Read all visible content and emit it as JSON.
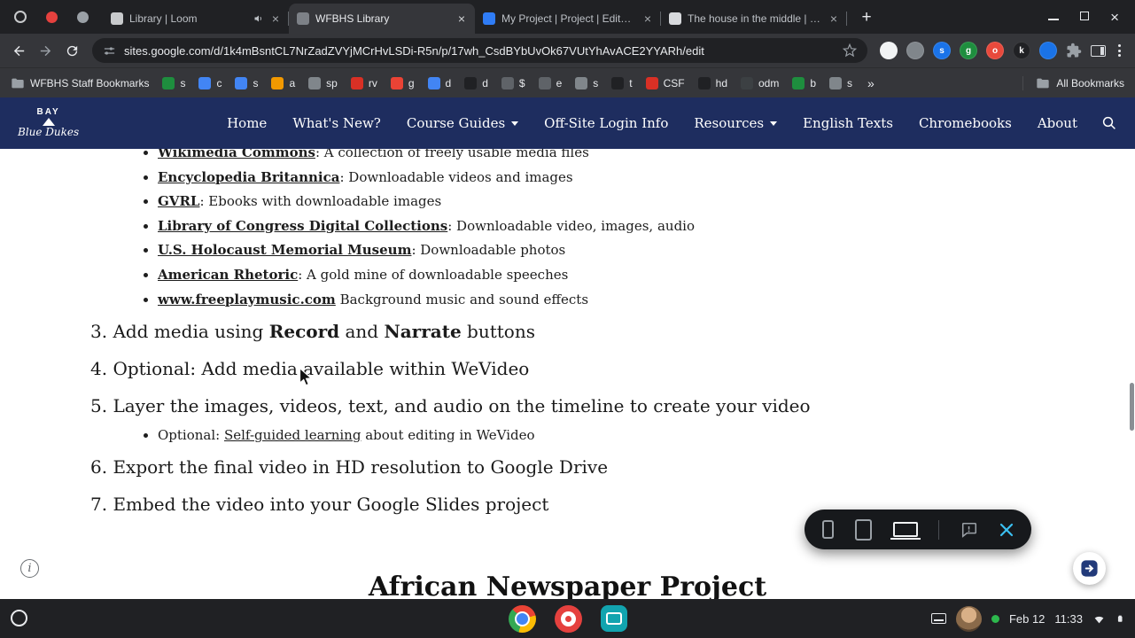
{
  "icons": {
    "close": "×",
    "new_tab": "+",
    "overflow": "»",
    "info": "i"
  },
  "browser": {
    "pinned": [
      {
        "color": "#c8cacc"
      },
      {
        "color": "#e5413e"
      },
      {
        "color": "#9aa0a6"
      }
    ],
    "tabs": [
      {
        "title": "Library | Loom",
        "favicon": "#c8cacc",
        "audio": true
      },
      {
        "title": "WFBHS Library",
        "favicon": "#7d8187",
        "active": true
      },
      {
        "title": "My Project | Project | Editor | W...",
        "favicon": "#2f7cf6"
      },
      {
        "title": "The house in the middle | Libra...",
        "favicon": "#d8dadd"
      }
    ],
    "toolbar": {
      "url": "sites.google.com/d/1k4mBsntCL7NrZadZVYjMCrHvLSDi-R5n/p/17wh_CsdBYbUvOk67VUtYhAvACE2YYARh/edit",
      "extensions": [
        {
          "label": "",
          "color": "#f1f3f4"
        },
        {
          "label": "",
          "color": "#80868b"
        },
        {
          "label": "s",
          "color": "#1a73e8"
        },
        {
          "label": "g",
          "color": "#1e8e3e"
        },
        {
          "label": "o",
          "color": "#e8493c"
        },
        {
          "label": "k",
          "color": "#202124"
        },
        {
          "label": "",
          "color": "#1a73e8"
        }
      ]
    },
    "bookmarks": {
      "folder": "WFBHS Staff Bookmarks",
      "items": [
        {
          "label": "s",
          "color": "#1e8e3e"
        },
        {
          "label": "c",
          "color": "#4285f4"
        },
        {
          "label": "s",
          "color": "#4285f4"
        },
        {
          "label": "a",
          "color": "#f29900"
        },
        {
          "label": "sp",
          "color": "#80868b"
        },
        {
          "label": "rv",
          "color": "#d93025"
        },
        {
          "label": "g",
          "color": "#ea4335"
        },
        {
          "label": "d",
          "color": "#4285f4"
        },
        {
          "label": "d",
          "color": "#202124"
        },
        {
          "label": "$",
          "color": "#5f6368"
        },
        {
          "label": "e",
          "color": "#5f6368"
        },
        {
          "label": "s",
          "color": "#80868b"
        },
        {
          "label": "t",
          "color": "#202124"
        },
        {
          "label": "CSF",
          "color": "#d93025"
        },
        {
          "label": "hd",
          "color": "#202124"
        },
        {
          "label": "odm",
          "color": "#3c4043"
        },
        {
          "label": "b",
          "color": "#1e8e3e"
        },
        {
          "label": "s",
          "color": "#80868b"
        }
      ],
      "all_bookmarks": "All Bookmarks"
    }
  },
  "site": {
    "logo": {
      "top": "BAY",
      "bottom": "Blue Dukes"
    },
    "nav": [
      {
        "label": "Home"
      },
      {
        "label": "What's New?"
      },
      {
        "label": "Course Guides",
        "dropdown": true
      },
      {
        "label": "Off-Site Login Info"
      },
      {
        "label": "Resources",
        "dropdown": true
      },
      {
        "label": "English Texts"
      },
      {
        "label": "Chromebooks"
      },
      {
        "label": "About"
      }
    ]
  },
  "page": {
    "resources": [
      {
        "link": "Wikimedia Commons",
        "desc": ": A collection of freely usable media files"
      },
      {
        "link": "Encyclopedia Britannica",
        "desc": ": Downloadable videos and images"
      },
      {
        "link": "GVRL",
        "desc": ": Ebooks with downloadable images"
      },
      {
        "link": "Library of Congress Digital Collections",
        "desc": ": Downloadable video, images, audio"
      },
      {
        "link": "U.S. Holocaust Memorial Museum",
        "desc": ": Downloadable photos"
      },
      {
        "link": "American Rhetoric",
        "desc": ": A gold mine of downloadable speeches"
      },
      {
        "link": "www.freeplaymusic.com",
        "desc": " Background music and sound effects"
      }
    ],
    "step3": {
      "pre": "3. Add media using ",
      "bold1": "Record",
      "mid": " and ",
      "bold2": "Narrate",
      "post": " buttons"
    },
    "step4": "4. Optional: Add media available within WeVideo",
    "step5": "5. Layer the images, videos, text, and audio on the timeline to create your video",
    "step5_sub": {
      "pre": "Optional: ",
      "link": "Self-guided learning",
      "post": " about editing in WeVideo"
    },
    "step6": "6. Export the final video in HD resolution to Google Drive",
    "step7": "7. Embed the video into your Google Slides project",
    "next_heading": "African Newspaper Project"
  },
  "preview_toolbar": {
    "close_color": "#3bc1f2"
  },
  "shelf": {
    "date": "Feb 12",
    "time": "11:33"
  }
}
